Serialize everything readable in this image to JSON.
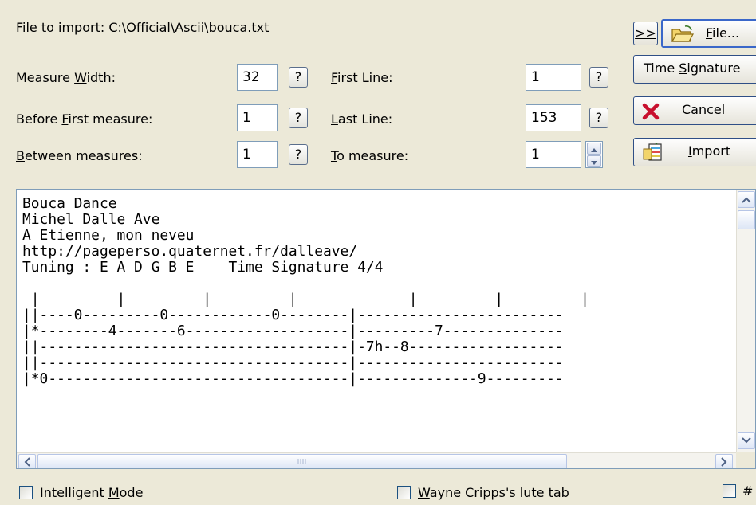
{
  "file_import": {
    "label": "File to import: C:\\Official\\Ascii\\bouca.txt"
  },
  "measure_width": {
    "label_pre": "Measure ",
    "label_ul": "W",
    "label_post": "idth:",
    "value": "32",
    "help": "?"
  },
  "before_first": {
    "label_pre": "Before ",
    "label_ul": "F",
    "label_post": "irst measure:",
    "value": "1",
    "help": "?"
  },
  "between": {
    "label_pre": "",
    "label_ul": "B",
    "label_post": "etween measures:",
    "value": "1",
    "help": "?"
  },
  "first_line": {
    "label_pre": "",
    "label_ul": "F",
    "label_post": "irst Line:",
    "value": "1",
    "help": "?"
  },
  "last_line": {
    "label_pre": "",
    "label_ul": "L",
    "label_post": "ast Line:",
    "value": "153",
    "help": "?"
  },
  "to_measure": {
    "label_pre": "",
    "label_ul": "T",
    "label_post": "o measure:",
    "value": "1"
  },
  "buttons": {
    "expand": ">>",
    "file_ul": "F",
    "file_post": "ile...",
    "time_sig_pre": "Time ",
    "time_sig_ul": "S",
    "time_sig_post": "ignature",
    "cancel": "Cancel",
    "import_ul": "I",
    "import_post": "mport"
  },
  "text_content": "Bouca Dance\nMichel Dalle Ave\nA Etienne, mon neveu\nhttp://pageperso.quaternet.fr/dalleave/\nTuning : E A D G B E    Time Signature 4/4\n\n |         |         |         |             |         |         |\n||----0---------0------------0--------|------------------------\n|*--------4-------6-------------------|---------7--------------\n||------------------------------------|-7h--8------------------\n||------------------------------------|------------------------\n|*0-----------------------------------|--------------9---------",
  "options": {
    "intelligent_pre": "Intelligent ",
    "intelligent_ul": "M",
    "intelligent_post": "ode",
    "wayne_pre": "",
    "wayne_ul": "W",
    "wayne_post": "ayne Cripps's lute tab",
    "third_partial": "#"
  },
  "icons": {
    "file": "folder-open-icon",
    "cancel": "red-x-icon",
    "import": "import-document-icon"
  },
  "colors": {
    "dialog_bg": "#ECE9D8",
    "cancel_x": "#C8102E",
    "field_border": "#7F9DB9"
  }
}
